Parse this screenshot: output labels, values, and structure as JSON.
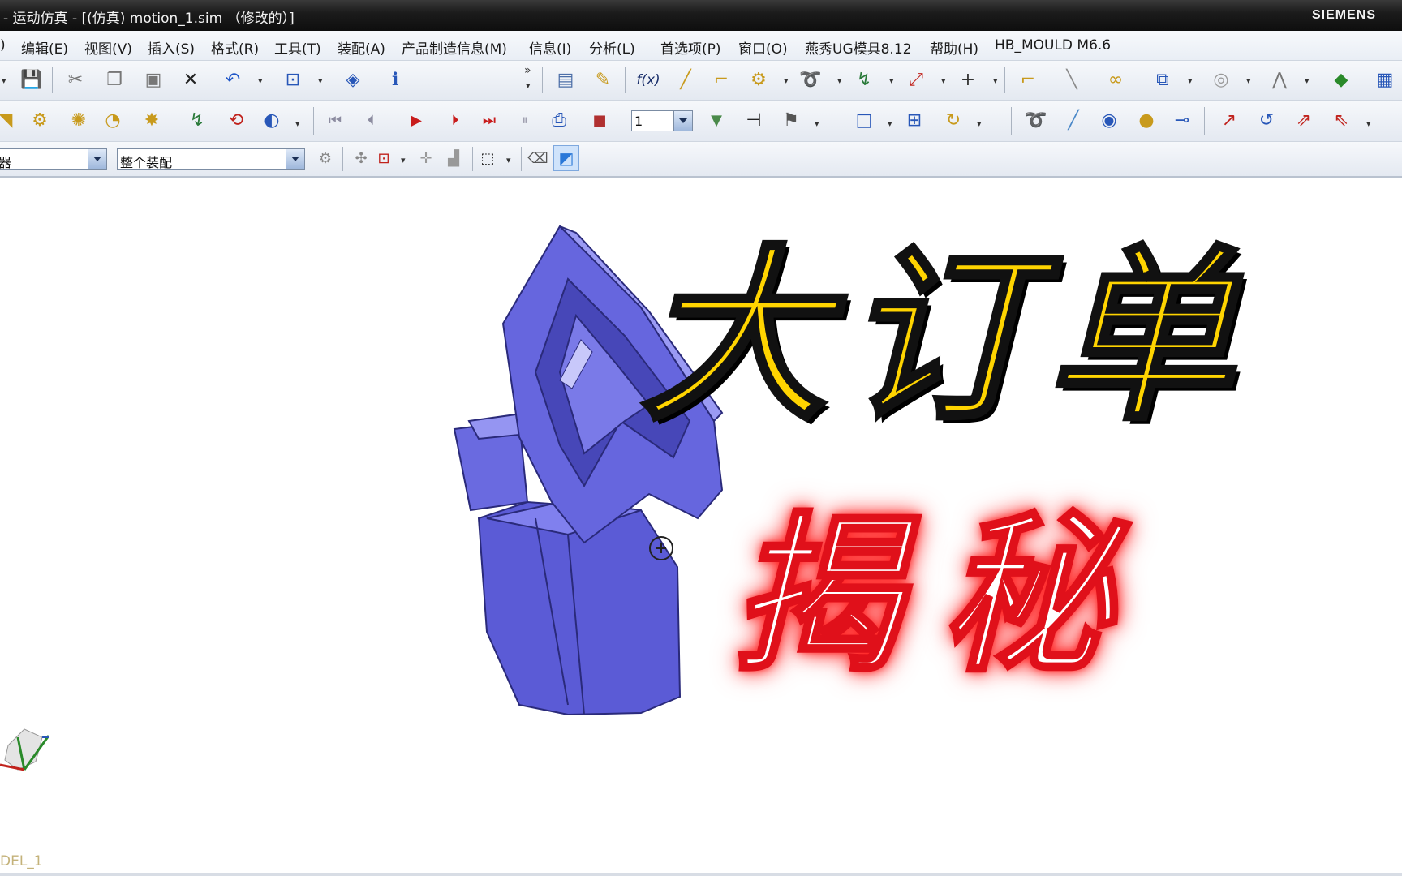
{
  "window": {
    "title": "- 运动仿真 - [(仿真) motion_1.sim （修改的）]",
    "brand": "SIEMENS"
  },
  "menu": [
    "编辑(E)",
    "视图(V)",
    "插入(S)",
    "格式(R)",
    "工具(T)",
    "装配(A)",
    "产品制造信息(M)",
    "信息(I)",
    "分析(L)",
    "首选项(P)",
    "窗口(O)",
    "燕秀UG模具8.12",
    "帮助(H)",
    "HB_MOULD M6.6"
  ],
  "menu_leading": ")",
  "toolbar3": {
    "filter_value": "器",
    "scope_value": "整个装配"
  },
  "animation": {
    "step_value": "1"
  },
  "overlay": {
    "title": "大订单",
    "subtitle": "揭秘"
  },
  "status": {
    "model_label": "DEL_1"
  },
  "colors": {
    "part": "#6f6fe6",
    "title_yellow": "#ffd400",
    "subtitle_glow": "#ff2020"
  }
}
